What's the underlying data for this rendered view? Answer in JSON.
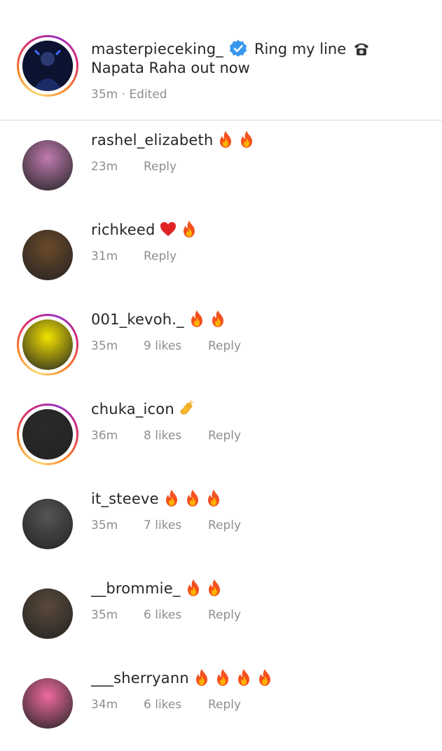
{
  "caption": {
    "username": "masterpieceking_",
    "text_line1": "Ring my line",
    "phone_emoji": "telephone",
    "text_line2": "Napata Raha out now",
    "time": "35m",
    "separator": "·",
    "edited": "Edited"
  },
  "comments": [
    {
      "username": "rashel_elizabeth",
      "emojis": [
        "fire",
        "fire"
      ],
      "time": "23m",
      "likes": "",
      "reply": "Reply",
      "ring": false,
      "avatar_color": "#c07bb0"
    },
    {
      "username": "richkeed",
      "emojis": [
        "heart",
        "fire"
      ],
      "time": "31m",
      "likes": "",
      "reply": "Reply",
      "ring": false,
      "avatar_color": "#6b4a2a"
    },
    {
      "username": "001_kevoh._",
      "emojis": [
        "fire",
        "fire"
      ],
      "time": "35m",
      "likes": "9 likes",
      "reply": "Reply",
      "ring": true,
      "avatar_color": "#f2e200"
    },
    {
      "username": "chuka_icon",
      "emojis": [
        "clap"
      ],
      "time": "36m",
      "likes": "8 likes",
      "reply": "Reply",
      "ring": true,
      "avatar_color": "#2a2a2a"
    },
    {
      "username": "it_steeve",
      "emojis": [
        "fire",
        "fire",
        "fire"
      ],
      "time": "35m",
      "likes": "7 likes",
      "reply": "Reply",
      "ring": false,
      "avatar_color": "#555555"
    },
    {
      "username": "__brommie_",
      "emojis": [
        "fire",
        "fire"
      ],
      "time": "35m",
      "likes": "6 likes",
      "reply": "Reply",
      "ring": false,
      "avatar_color": "#5a4a3a"
    },
    {
      "username": "___sherryann",
      "emojis": [
        "fire",
        "fire",
        "fire",
        "fire"
      ],
      "time": "34m",
      "likes": "6 likes",
      "reply": "Reply",
      "ring": false,
      "avatar_color": "#f06aa0"
    }
  ],
  "colors": {
    "text": "#262626",
    "meta": "#8e8e8e",
    "verified": "#3897f0",
    "divider": "#dbdbdb"
  }
}
